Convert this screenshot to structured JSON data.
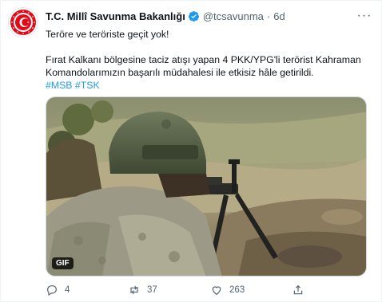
{
  "tweet": {
    "display_name": "T.C. Millî Savunma Bakanlığı",
    "handle": "@tcsavunma",
    "separator": "·",
    "time": "6d",
    "more_label": "···",
    "text_line1": "Teröre ve teröriste geçit yok!",
    "text_line2": "Fırat Kalkanı bölgesine taciz atışı yapan 4 PKK/YPG'li terörist Kahraman",
    "text_line3": "Komandolarımızın başarılı müdahalesi ile etkisiz hâle getirildi.",
    "hashtags": [
      "#MSB",
      "#TSK"
    ],
    "media_badge": "GIF",
    "colors": {
      "accent": "#1d9bf0",
      "secondary_text": "#536471",
      "emblem_red": "#e30a17"
    },
    "icons": {
      "avatar": "msb-emblem-icon",
      "verified": "verified-badge-icon",
      "reply": "reply-icon",
      "retweet": "retweet-icon",
      "like": "heart-icon",
      "share": "share-icon"
    }
  },
  "actions": {
    "reply_count": "4",
    "retweet_count": "37",
    "like_count": "263"
  }
}
